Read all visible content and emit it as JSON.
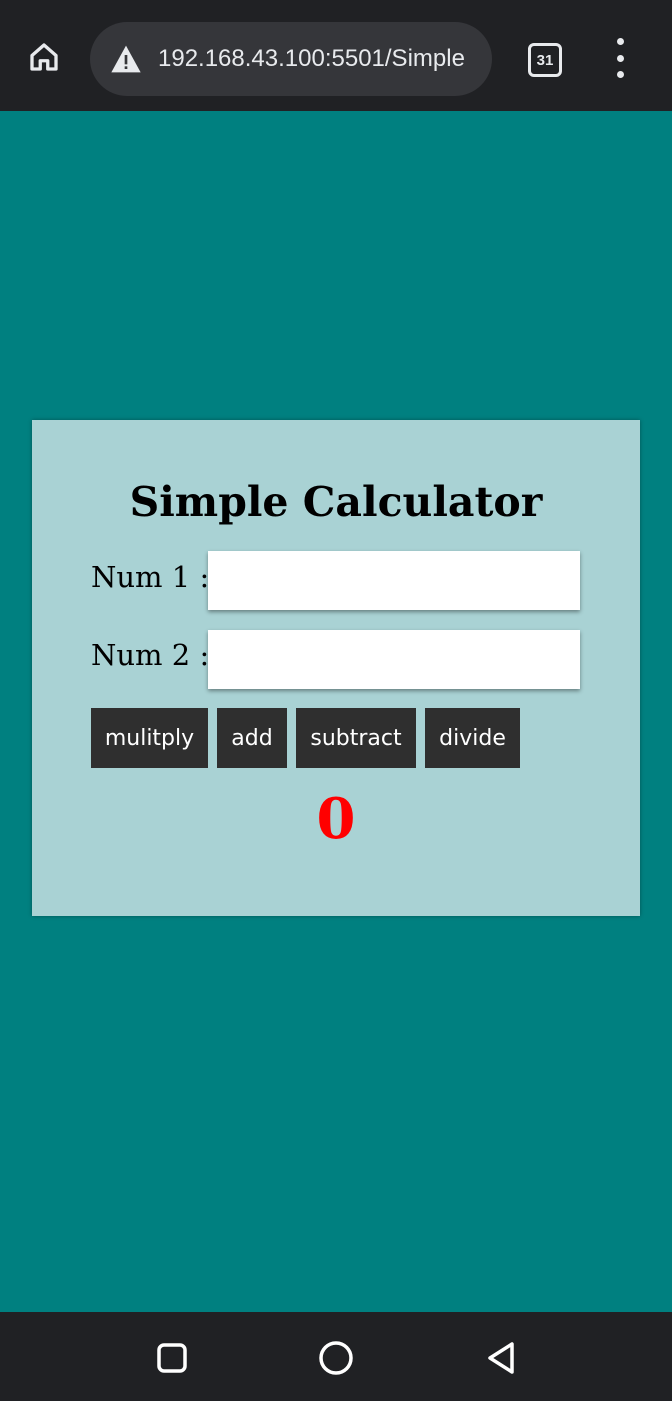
{
  "browser": {
    "url": "192.168.43.100:5501/Simple",
    "tab_count": "31",
    "icons": {
      "home": "home-icon",
      "warning": "warning-icon",
      "tabs": "tabs-icon",
      "menu": "more-vert-icon"
    }
  },
  "calculator": {
    "title": "Simple Calculator",
    "num1_label": "Num 1 :",
    "num2_label": "Num 2 :",
    "num1_value": "",
    "num2_value": "",
    "buttons": {
      "multiply": "mulitply",
      "add": "add",
      "subtract": "subtract",
      "divide": "divide"
    },
    "result": "0"
  },
  "colors": {
    "page_background": "#008080",
    "card_background": "#a9d2d4",
    "button_background": "#2f2f2f",
    "result_color": "#ff0000"
  },
  "system_nav": {
    "icons": [
      "recents-icon",
      "home-circle-icon",
      "back-icon"
    ]
  }
}
